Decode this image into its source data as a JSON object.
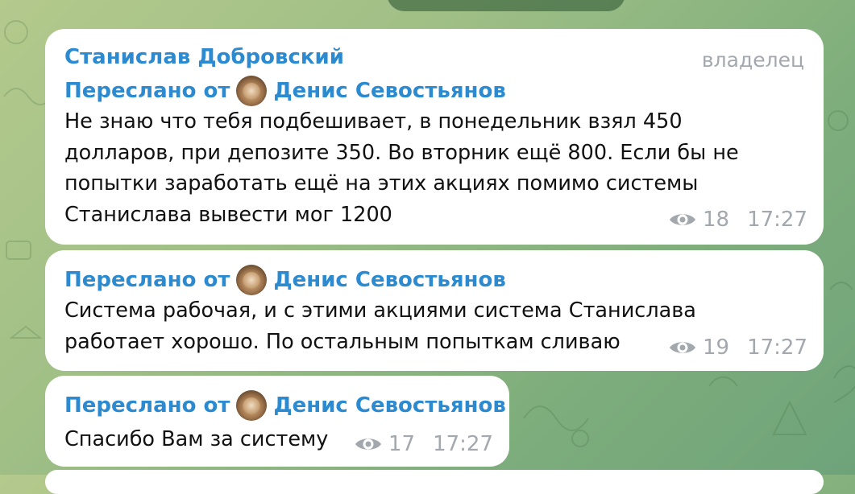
{
  "messages": [
    {
      "sender": "Станислав Добровский",
      "role": "владелец",
      "forward_prefix": "Переслано от",
      "forward_name": "Денис Севостьянов",
      "lines": [
        "Не знаю что тебя подбешивает, в понедельник взял 450",
        "долларов, при депозите 350. Во вторник ещё 800. Если бы не",
        "попытки заработать ещё на этих акциях помимо системы",
        "Станислава вывести мог 1200"
      ],
      "views": "18",
      "time": "17:27"
    },
    {
      "forward_prefix": "Переслано от",
      "forward_name": "Денис Севостьянов",
      "lines": [
        "Система рабочая, и с этими акциями система Станислава",
        "работает хорошо. По остальным попыткам сливаю"
      ],
      "views": "19",
      "time": "17:27"
    },
    {
      "forward_prefix": "Переслано от",
      "forward_name": "Денис Севостьянов",
      "lines": [
        "Спасибо Вам за систему"
      ],
      "views": "17",
      "time": "17:27"
    }
  ],
  "icons": {
    "views": "eye-icon",
    "avatar": "forwarded-user-avatar"
  },
  "colors": {
    "name_blue": "#2c8ad0",
    "meta_gray": "#a3a8ae"
  }
}
